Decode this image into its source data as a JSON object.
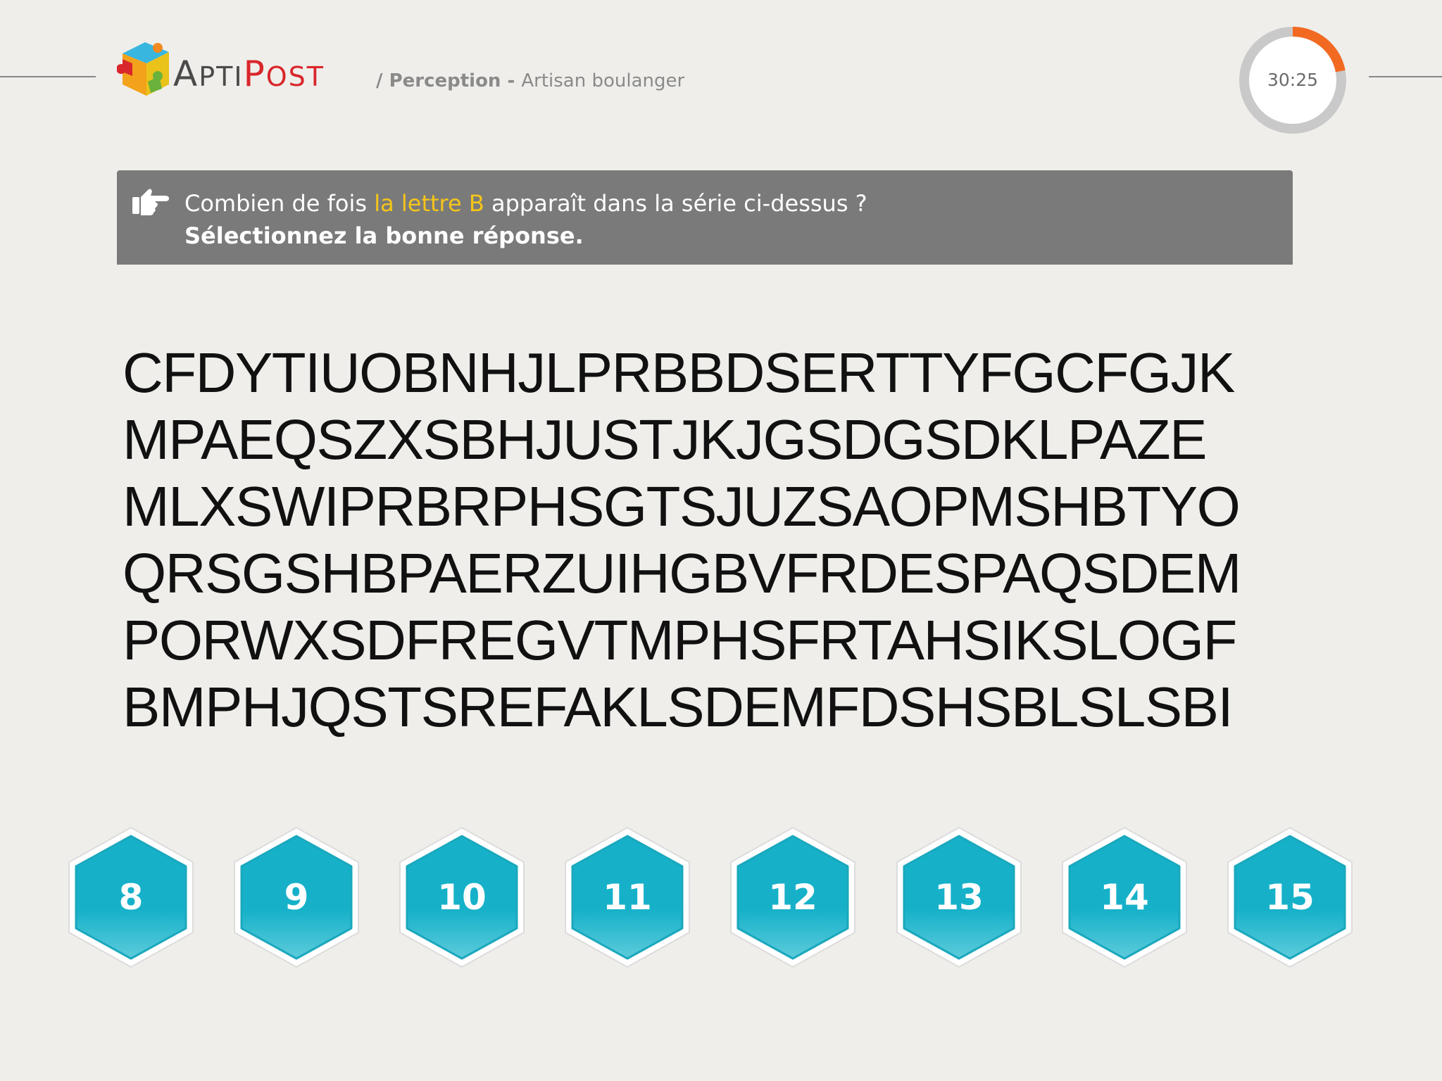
{
  "header": {
    "brand_part1": "A",
    "brand_part1_rest": "PTI",
    "brand_part2": "P",
    "brand_part2_rest": "OST",
    "breadcrumb_prefix": "/ ",
    "category": "Perception",
    "separator": " - ",
    "job": "Artisan boulanger"
  },
  "timer": {
    "value": "30:25",
    "elapsed_fraction": 0.22
  },
  "question": {
    "text_before": "Combien de fois ",
    "highlight": "la lettre B",
    "text_after": " apparaît dans la série ci-dessus ?",
    "instruction": "Sélectionnez la bonne réponse."
  },
  "series": [
    "CFDYTIUOBNHJLPRBBDSERTTYFGCFGJK",
    "MPAEQSZXSBHJUSTJKJGSDGSDKLPAZE",
    "MLXSWIPRBRPHSGTSJUZSAOPMSHBTYO",
    "QRSGSHBPAERZUIHGBVFRDESPAQSDEM",
    "PORWXSDFREGVTMPHSFRTAHSIKSLOGF",
    "BMPHJQSTSREFAKLSDEMFDSHSBLSLSBI"
  ],
  "answers": [
    "8",
    "9",
    "10",
    "11",
    "12",
    "13",
    "14",
    "15"
  ],
  "colors": {
    "background": "#efeeea",
    "banner": "#7a7a7a",
    "highlight": "#f5c518",
    "answer_top": "#16b1c9",
    "answer_bottom": "#52c8d8",
    "timer_progress": "#f26a22",
    "timer_track": "#c9c9c9"
  }
}
